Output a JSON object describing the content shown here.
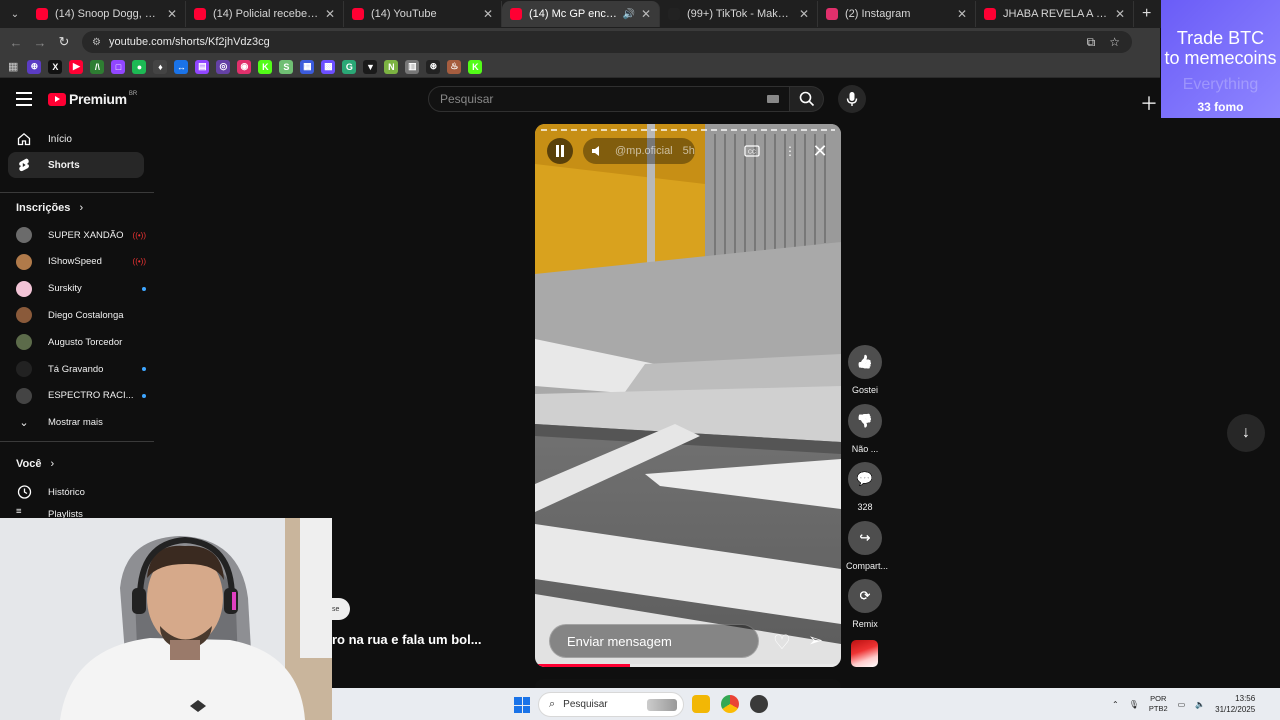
{
  "browser": {
    "tabs": [
      {
        "title": "(14) Snoop Dogg, Tupac, Nate",
        "fav_color": "#ff0033",
        "active": false,
        "audio": false
      },
      {
        "title": "(14) Policial recebe voz de prisã",
        "fav_color": "#ff0033",
        "active": false,
        "audio": false
      },
      {
        "title": "(14) YouTube",
        "fav_color": "#ff0033",
        "active": false,
        "audio": false
      },
      {
        "title": "(14) Mc GP encontra Vinhe",
        "fav_color": "#ff0033",
        "active": true,
        "audio": true
      },
      {
        "title": "(99+) TikTok - Make Your Day",
        "fav_color": "#222222",
        "active": false,
        "audio": false
      },
      {
        "title": "(2) Instagram",
        "fav_color": "#e1306c",
        "active": false,
        "audio": false
      },
      {
        "title": "JHABA REVELA A LÉO STROND",
        "fav_color": "#ff0033",
        "active": false,
        "audio": false
      }
    ],
    "url": "youtube.com/shorts/Kf2jhVdz3cg",
    "bookmarks": [
      {
        "glyph": "⊕",
        "color": "#5b3cc4"
      },
      {
        "glyph": "X",
        "color": "#111111"
      },
      {
        "glyph": "▶",
        "color": "#ff0033"
      },
      {
        "glyph": "/\\",
        "color": "#2e7d32"
      },
      {
        "glyph": "□",
        "color": "#9146ff"
      },
      {
        "glyph": "●",
        "color": "#1db954"
      },
      {
        "glyph": "♦",
        "color": "#444444"
      },
      {
        "glyph": "↔",
        "color": "#1a73e8"
      },
      {
        "glyph": "▤",
        "color": "#9146ff"
      },
      {
        "glyph": "◎",
        "color": "#6441a5"
      },
      {
        "glyph": "◉",
        "color": "#e1306c"
      },
      {
        "glyph": "K",
        "color": "#53fc18"
      },
      {
        "glyph": "S",
        "color": "#6fbf73"
      },
      {
        "glyph": "▦",
        "color": "#3b5bdb"
      },
      {
        "glyph": "▩",
        "color": "#6b4eff"
      },
      {
        "glyph": "G",
        "color": "#2aa876"
      },
      {
        "glyph": "▼",
        "color": "#1a1a1a"
      },
      {
        "glyph": "N",
        "color": "#7cb342"
      },
      {
        "glyph": "▥",
        "color": "#777777"
      },
      {
        "glyph": "⊛",
        "color": "#222222"
      },
      {
        "glyph": "♨",
        "color": "#a65d3f"
      },
      {
        "glyph": "K",
        "color": "#53fc18"
      }
    ]
  },
  "ad": {
    "line1": "Trade BTC",
    "line2": "to memecoins",
    "line3": "Everything",
    "brand": "33 fomo"
  },
  "youtube": {
    "logo_word": "Premium",
    "country": "BR",
    "search_placeholder": "Pesquisar",
    "sidebar": {
      "main": [
        {
          "label": "Início",
          "icon": "home-icon"
        },
        {
          "label": "Shorts",
          "icon": "shorts-icon",
          "active": true
        }
      ],
      "subs_header": "Inscrições",
      "subs": [
        {
          "name": "SUPER XANDÃO",
          "status": "live",
          "avatar": "#6b6b6b"
        },
        {
          "name": "IShowSpeed",
          "status": "live",
          "avatar": "#b07a4a"
        },
        {
          "name": "Surskity",
          "status": "new",
          "avatar": "#f2c4d6"
        },
        {
          "name": "Diego Costalonga",
          "status": "",
          "avatar": "#8a5a3a"
        },
        {
          "name": "Augusto Torcedor",
          "status": "",
          "avatar": "#5c6b4a"
        },
        {
          "name": "Tá Gravando",
          "status": "new",
          "avatar": "#222222"
        },
        {
          "name": "ESPECTRO RACI...",
          "status": "new",
          "avatar": "#444444"
        }
      ],
      "more_label": "Mostrar mais",
      "you_header": "Você",
      "history_label": "Histórico",
      "playlists_label": "Playlists"
    },
    "short": {
      "channel": "@mp.oficial",
      "time": "5h",
      "message_placeholder": "Enviar mensagem",
      "progress": 0.31,
      "caption": "ro na rua e fala um bol...",
      "chip_text": "se"
    },
    "actions": [
      {
        "label": "Gostei",
        "icon": "like-icon",
        "glyph": "👍"
      },
      {
        "label": "Não ...",
        "icon": "dislike-icon",
        "glyph": "👎"
      },
      {
        "label": "328",
        "icon": "comment-icon",
        "glyph": "💬"
      },
      {
        "label": "Compart...",
        "icon": "share-icon",
        "glyph": "↪"
      },
      {
        "label": "Remix",
        "icon": "remix-icon",
        "glyph": "⟳"
      }
    ]
  },
  "taskbar": {
    "search_placeholder": "Pesquisar",
    "lang_line1": "POR",
    "lang_line2": "PTB2",
    "time": "13:56",
    "date": "31/12/2025"
  }
}
